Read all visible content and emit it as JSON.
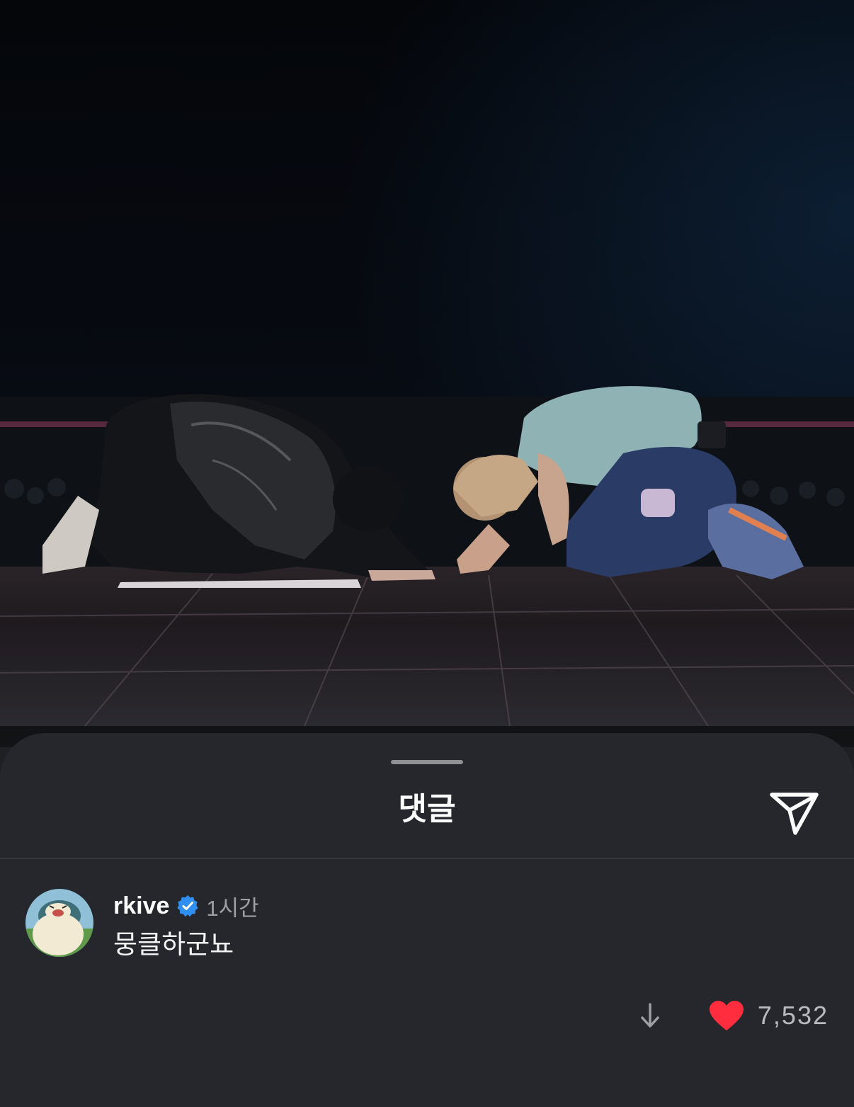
{
  "sheet": {
    "title": "댓글",
    "share_icon": "send-icon"
  },
  "comment": {
    "username": "rkive",
    "verified": true,
    "time": "1시간",
    "text": "뭉클하군뇨",
    "like_count": "7,532",
    "liked": true,
    "icons": {
      "avatar": "snorlax-avatar",
      "verified": "verified-badge-icon",
      "more": "arrow-down-icon",
      "like": "heart-icon"
    }
  },
  "colors": {
    "sheet_bg": "#25272c",
    "verified": "#2f8ff2",
    "heart": "#ff2d3d",
    "muted_text": "#9c9fa4"
  }
}
